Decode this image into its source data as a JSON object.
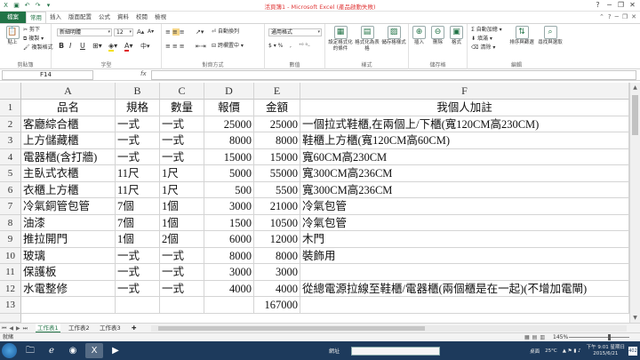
{
  "window": {
    "title": "活頁簿1 - Microsoft Excel (產品啟動失敗)",
    "min_icon": "minimize-icon",
    "max_icon": "restore-icon",
    "close_icon": "close-icon"
  },
  "ribbon_tabs": [
    "檔案",
    "常用",
    "插入",
    "版面配置",
    "公式",
    "資料",
    "校閱",
    "檢視"
  ],
  "active_tab": "常用",
  "ribbon": {
    "clipboard": {
      "label": "剪貼簿",
      "paste": "貼上",
      "cut": "剪下",
      "copy": "複製 ▾",
      "format_painter": "複製格式"
    },
    "font": {
      "label": "字型",
      "font_name": "新細明體",
      "font_size": "12",
      "bold": "B",
      "italic": "I",
      "underline": "U",
      "grow": "A",
      "shrink": "A"
    },
    "alignment": {
      "label": "對齊方式",
      "wrap": "自動換列",
      "merge": "跨欄置中 ▾"
    },
    "number": {
      "label": "數值",
      "format": "通用格式",
      "currency": "$ ▾ %",
      "separator": ","
    },
    "styles": {
      "label": "樣式",
      "conditional": "設定格式化的條件",
      "as_table": "格式化為表格",
      "cell_styles": "儲存格樣式"
    },
    "cells": {
      "label": "儲存格",
      "insert": "插入",
      "delete": "刪除",
      "format": "格式"
    },
    "editing": {
      "label": "編輯",
      "autosum": "Σ 自動加總 ▾",
      "fill": "填滿 ▾",
      "clear": "清除 ▾",
      "sort": "排序與篩選",
      "find": "尋找與選取"
    }
  },
  "formula_bar": {
    "name_box": "F14",
    "fx": "fx",
    "content": ""
  },
  "columns": [
    "A",
    "B",
    "C",
    "D",
    "E",
    "F"
  ],
  "rows": [
    {
      "n": "1",
      "a": "品名",
      "b": "規格",
      "c": "數量",
      "d": "報價",
      "e": "金額",
      "f": "我個人加註"
    },
    {
      "n": "2",
      "a": "客廳綜合櫃",
      "b": "一式",
      "c": "一式",
      "d": "25000",
      "e": "25000",
      "f": "一個拉式鞋櫃,在兩個上/下櫃(寬120CM高230CM)"
    },
    {
      "n": "3",
      "a": "上方儲藏櫃",
      "b": "一式",
      "c": "一式",
      "d": "8000",
      "e": "8000",
      "f": "鞋櫃上方櫃(寬120CM高60CM)"
    },
    {
      "n": "4",
      "a": "電器櫃(含打牆)",
      "b": "一式",
      "c": "一式",
      "d": "15000",
      "e": "15000",
      "f": "寬60CM高230CM"
    },
    {
      "n": "5",
      "a": "主臥式衣櫃",
      "b": "11尺",
      "c": "1尺",
      "d": "5000",
      "e": "55000",
      "f": "寬300CM高236CM"
    },
    {
      "n": "6",
      "a": "衣櫃上方櫃",
      "b": "11尺",
      "c": "1尺",
      "d": "500",
      "e": "5500",
      "f": "寬300CM高236CM"
    },
    {
      "n": "7",
      "a": "冷氣銅管包管",
      "b": "7個",
      "c": "1個",
      "d": "3000",
      "e": "21000",
      "f": "冷氣包管"
    },
    {
      "n": "8",
      "a": "油漆",
      "b": "7個",
      "c": "1個",
      "d": "1500",
      "e": "10500",
      "f": "冷氣包管"
    },
    {
      "n": "9",
      "a": "推拉開門",
      "b": "1個",
      "c": "2個",
      "d": "6000",
      "e": "12000",
      "f": "木門"
    },
    {
      "n": "10",
      "a": "玻璃",
      "b": "一式",
      "c": "一式",
      "d": "8000",
      "e": "8000",
      "f": "裝飾用"
    },
    {
      "n": "11",
      "a": "保護板",
      "b": "一式",
      "c": "一式",
      "d": "3000",
      "e": "3000",
      "f": ""
    },
    {
      "n": "12",
      "a": "水電整修",
      "b": "一式",
      "c": "一式",
      "d": "4000",
      "e": "4000",
      "f": "從總電源拉線至鞋櫃/電器櫃(兩個櫃是在一起)(不增加電閘)"
    },
    {
      "n": "13",
      "a": "",
      "b": "",
      "c": "",
      "d": "",
      "e": "167000",
      "f": ""
    }
  ],
  "sheets": [
    "工作表1",
    "工作表2",
    "工作表3"
  ],
  "active_sheet": "工作表1",
  "status": {
    "ready": "就緒",
    "zoom": "145%"
  },
  "taskbar": {
    "address_label": "網址",
    "desktop_label": "桌面",
    "weather": "25°C",
    "time": "下午 9:01 星期日",
    "date": "2015/6/21",
    "notifications": "402"
  }
}
